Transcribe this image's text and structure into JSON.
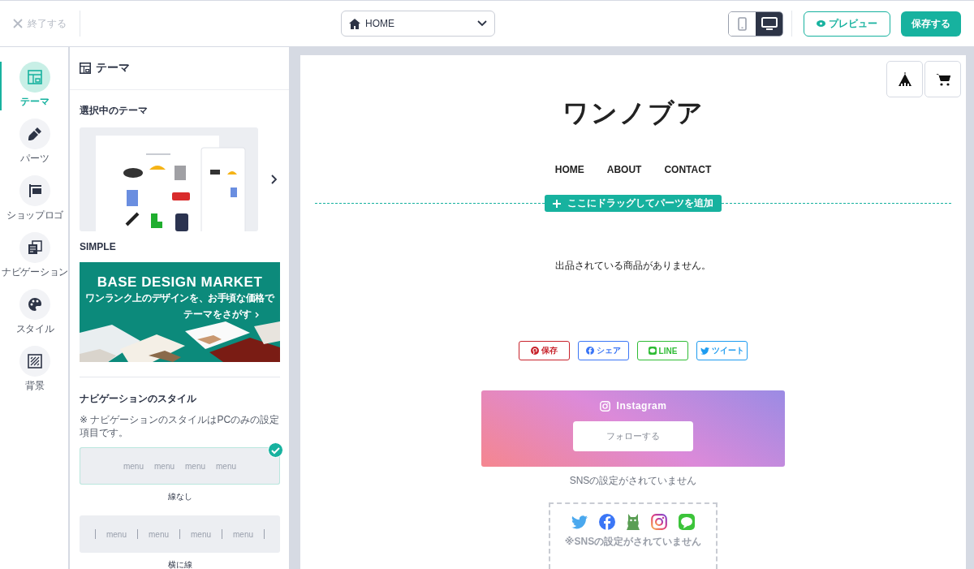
{
  "topbar": {
    "exit_label": "終了する",
    "page_select": {
      "value": "HOME"
    },
    "devices": [
      {
        "kind": "mobile",
        "selected": false
      },
      {
        "kind": "desktop",
        "selected": true
      }
    ],
    "preview_label": "プレビュー",
    "save_label": "保存する"
  },
  "rail": [
    {
      "kind": "theme",
      "label": "テーマ",
      "selected": true
    },
    {
      "kind": "parts",
      "label": "パーツ",
      "selected": false
    },
    {
      "kind": "logo",
      "label": "ショップロゴ",
      "selected": false
    },
    {
      "kind": "navigation",
      "label": "ナビゲーション",
      "selected": false
    },
    {
      "kind": "style",
      "label": "スタイル",
      "selected": false
    },
    {
      "kind": "background",
      "label": "背景",
      "selected": false
    }
  ],
  "panel": {
    "title": "テーマ",
    "current_theme_heading": "選択中のテーマ",
    "theme_name": "SIMPLE",
    "banner": {
      "title": "BASE DESIGN MARKET",
      "subtitle": "ワンランク上のデザインを、お手頃な価格で",
      "link": "テーマをさがす"
    },
    "nav_style": {
      "heading": "ナビゲーションのスタイル",
      "note": "※ ナビゲーションのスタイルはPCのみの設定項目です。",
      "options": [
        {
          "kind": "plain",
          "menu": [
            "menu",
            "menu",
            "menu",
            "menu"
          ],
          "label": "線なし",
          "selected": true
        },
        {
          "kind": "divided",
          "menu": [
            "menu",
            "menu",
            "menu",
            "menu"
          ],
          "label": "横に線",
          "selected": false
        }
      ]
    }
  },
  "preview": {
    "shop_name": "ワンノブア",
    "nav": [
      "HOME",
      "ABOUT",
      "CONTACT"
    ],
    "drop_zone_label": "ここにドラッグしてパーツを追加",
    "empty_message": "出品されている商品がありません。",
    "share_buttons": [
      {
        "kind": "pinterest",
        "label": "保存",
        "color": "#c8232c"
      },
      {
        "kind": "facebook",
        "label": "シェア",
        "color": "#3b76f6"
      },
      {
        "kind": "line",
        "label": "LINE",
        "color": "#2fbc35"
      },
      {
        "kind": "twitter",
        "label": "ツイート",
        "color": "#1d9bf0"
      }
    ],
    "instagram": {
      "title": "Instagram",
      "button": "フォローする",
      "note": "SNSの設定がされていません"
    },
    "sns_note": "※SNSの設定がされていません"
  }
}
